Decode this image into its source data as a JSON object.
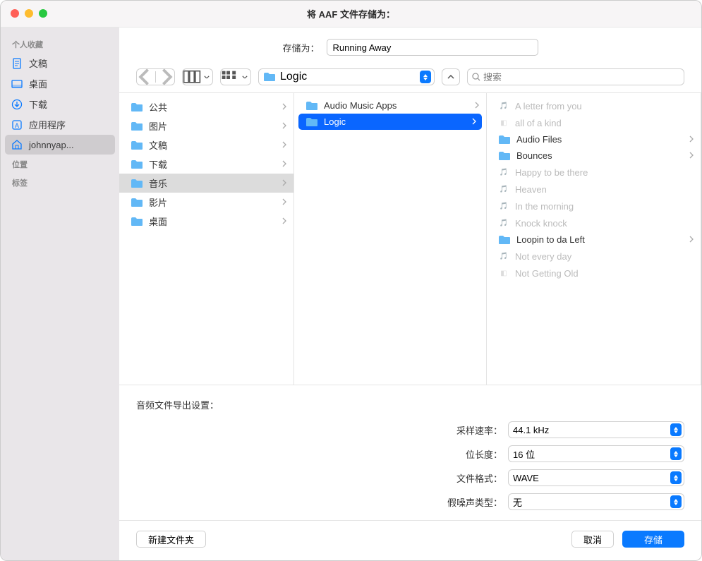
{
  "title": "将 AAF 文件存储为：",
  "save": {
    "label": "存储为：",
    "value": "Running Away"
  },
  "toolbar": {
    "path": "Logic",
    "search_placeholder": "搜索"
  },
  "sidebar": {
    "sections": [
      {
        "header": "个人收藏",
        "items": [
          {
            "label": "文稿",
            "icon": "doc"
          },
          {
            "label": "桌面",
            "icon": "desktop"
          },
          {
            "label": "下载",
            "icon": "download"
          },
          {
            "label": "应用程序",
            "icon": "apps"
          },
          {
            "label": "johnnyap...",
            "icon": "home",
            "selected": true
          }
        ]
      },
      {
        "header": "位置",
        "items": []
      },
      {
        "header": "标签",
        "items": []
      }
    ]
  },
  "columns": {
    "c1": [
      {
        "label": "公共",
        "type": "folder",
        "chev": true
      },
      {
        "label": "图片",
        "type": "folder",
        "chev": true
      },
      {
        "label": "文稿",
        "type": "folder",
        "chev": true
      },
      {
        "label": "下载",
        "type": "folder",
        "chev": true
      },
      {
        "label": "音乐",
        "type": "folder",
        "chev": true,
        "sel": "gray"
      },
      {
        "label": "影片",
        "type": "folder",
        "chev": true
      },
      {
        "label": "桌面",
        "type": "folder",
        "chev": true
      }
    ],
    "c2": [
      {
        "label": "Audio Music Apps",
        "type": "folder",
        "chev": true
      },
      {
        "label": "Logic",
        "type": "folder",
        "chev": true,
        "sel": "blue"
      }
    ],
    "c3": [
      {
        "label": "A letter from you",
        "type": "logic",
        "dim": true
      },
      {
        "label": "all of a kind",
        "type": "gb",
        "dim": true
      },
      {
        "label": "Audio Files",
        "type": "folder",
        "chev": true
      },
      {
        "label": "Bounces",
        "type": "folder",
        "chev": true
      },
      {
        "label": "Happy to be there",
        "type": "logic",
        "dim": true
      },
      {
        "label": "Heaven",
        "type": "logic",
        "dim": true
      },
      {
        "label": "In the morning",
        "type": "logic",
        "dim": true
      },
      {
        "label": "Knock knock",
        "type": "logic",
        "dim": true
      },
      {
        "label": "Loopin to da Left",
        "type": "folder",
        "chev": true
      },
      {
        "label": "Not every day",
        "type": "logic",
        "dim": true
      },
      {
        "label": "Not Getting Old",
        "type": "gb",
        "dim": true
      }
    ]
  },
  "settings": {
    "title": "音频文件导出设置：",
    "rows": [
      {
        "label": "采样速率：",
        "value": "44.1 kHz"
      },
      {
        "label": "位长度：",
        "value": "16 位"
      },
      {
        "label": "文件格式：",
        "value": "WAVE"
      },
      {
        "label": "假噪声类型：",
        "value": "无"
      }
    ]
  },
  "footer": {
    "new_folder": "新建文件夹",
    "cancel": "取消",
    "save": "存储"
  }
}
